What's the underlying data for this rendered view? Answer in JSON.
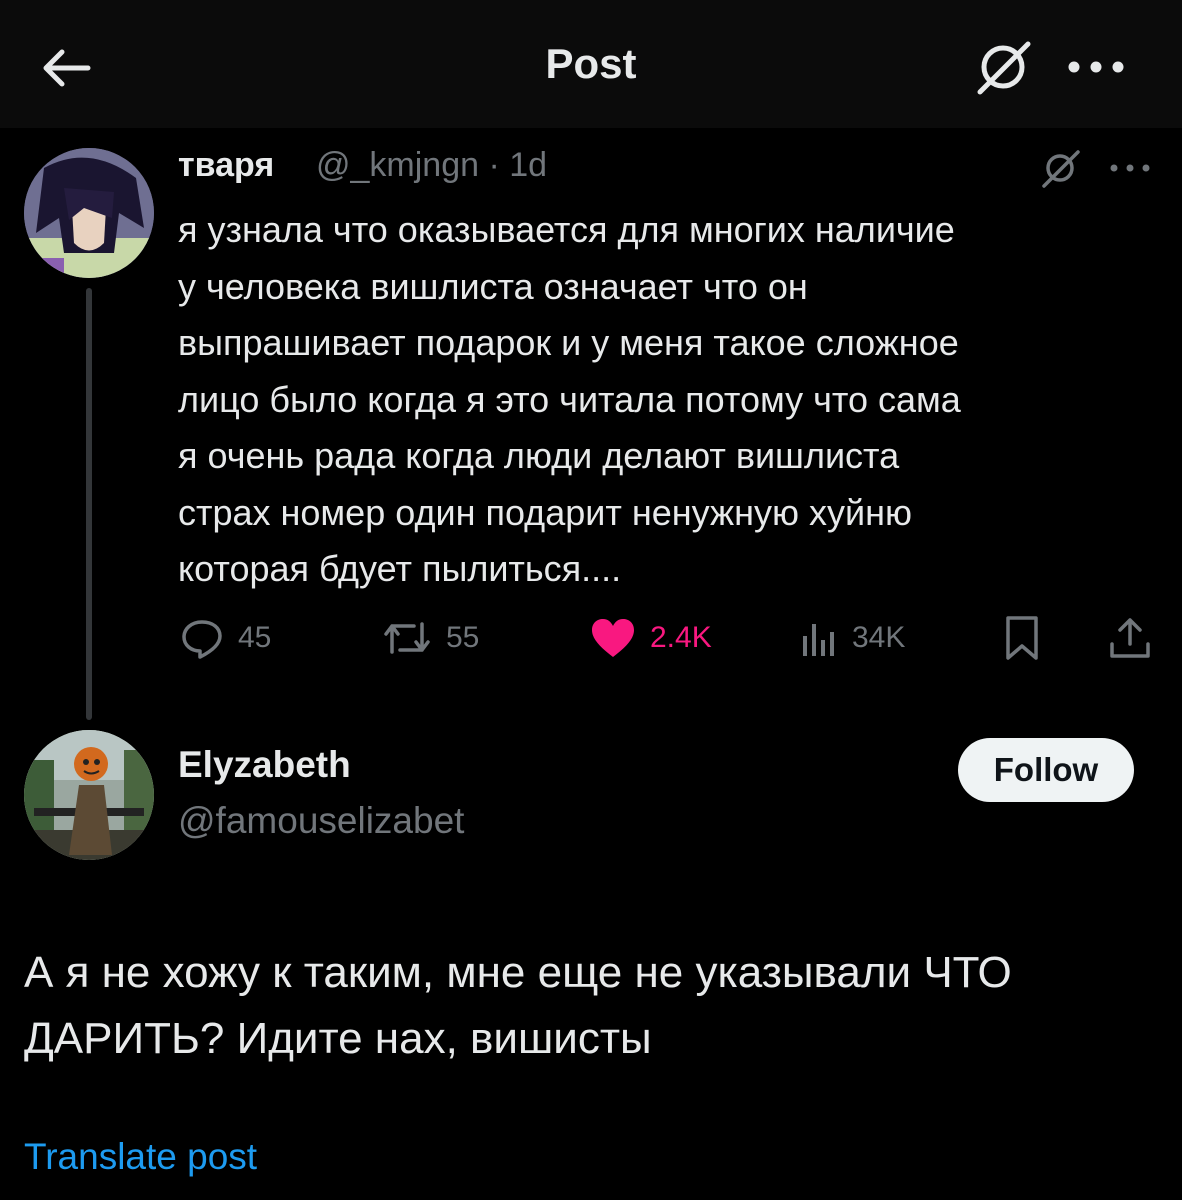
{
  "header": {
    "title": "Post",
    "back_icon": "arrow-left-icon",
    "grok_icon": "grok-icon",
    "more_icon": "more-horizontal-icon"
  },
  "parent_post": {
    "author_name": "тваря",
    "author_handle": "@_kmjngn",
    "time": "· 1d",
    "text_lines": [
      "я узнала что оказывается для многих наличие",
      "у человека вишлиста означает что он",
      "выпрашивает подарок и у меня такое сложное",
      "лицо было когда я это читала потому что сама",
      "я очень рада когда люди делают вишлиста",
      "страх номер один подарит ненужную хуйню",
      "которая бдует пылиться...."
    ],
    "stats": {
      "replies": "45",
      "reposts": "55",
      "likes": "2.4K",
      "views": "34K"
    }
  },
  "reply": {
    "author_name": "Elyzabeth",
    "author_handle": "@famouselizabet",
    "follow_label": "Follow",
    "text_lines": [
      "А я не хожу к таким, мне еще не указывали ЧТО",
      "ДАРИТЬ? Идите нах, вишисты"
    ],
    "translate_label": "Translate post"
  },
  "colors": {
    "background": "#000000",
    "text": "#e7e9ea",
    "muted": "#71767b",
    "like": "#f91880",
    "link": "#1d9bf0"
  }
}
